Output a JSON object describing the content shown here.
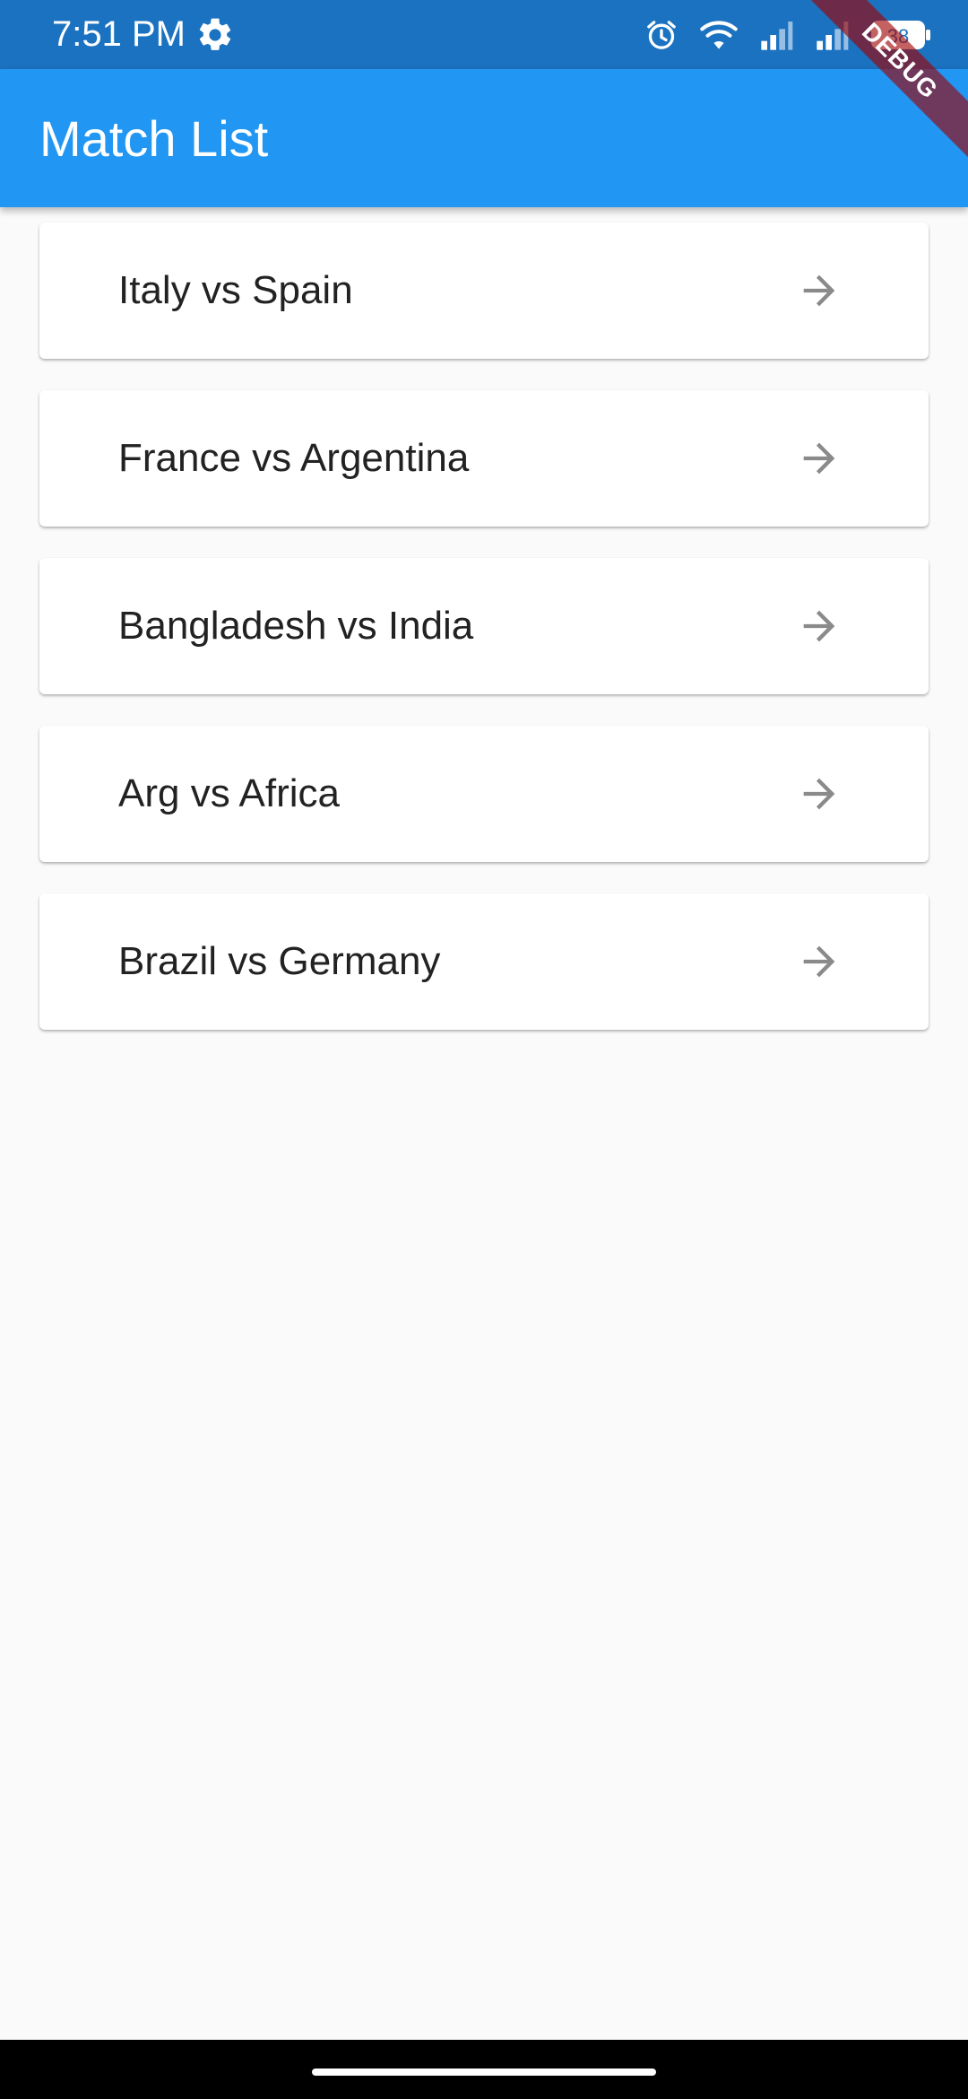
{
  "status_bar": {
    "time": "7:51 PM",
    "icons": [
      "gear-icon",
      "alarm-icon",
      "wifi-icon",
      "signal-icon",
      "signal-icon",
      "battery-icon"
    ],
    "battery_level": "38",
    "bg_color": "#1b72c0"
  },
  "app_bar": {
    "title": "Match List",
    "bg_color": "#2196f3"
  },
  "debug_banner": {
    "label": "DEBUG"
  },
  "matches": [
    {
      "title": "Italy vs Spain",
      "icon": "arrow-forward-icon"
    },
    {
      "title": "France vs Argentina",
      "icon": "arrow-forward-icon"
    },
    {
      "title": "Bangladesh vs India",
      "icon": "arrow-forward-icon"
    },
    {
      "title": "Arg vs Africa",
      "icon": "arrow-forward-icon"
    },
    {
      "title": "Brazil vs Germany",
      "icon": "arrow-forward-icon"
    }
  ]
}
